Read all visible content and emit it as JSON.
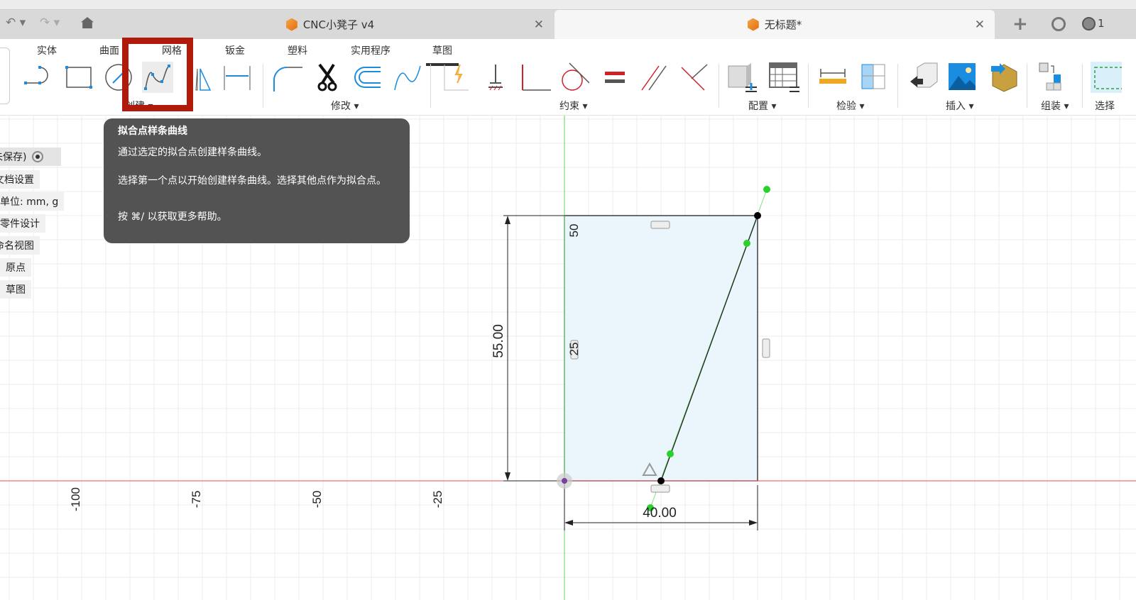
{
  "tabs": [
    {
      "label": "CNC小凳子 v4",
      "active": false
    },
    {
      "label": "无标题*",
      "active": true
    }
  ],
  "tabbar_right": {
    "add": "+",
    "jobs_count": "1"
  },
  "categories": [
    "实体",
    "曲面",
    "网格",
    "钣金",
    "塑料",
    "实用程序",
    "草图"
  ],
  "active_category": "草图",
  "groups": {
    "create": "创建",
    "modify": "修改",
    "constrain": "约束",
    "configure": "配置",
    "inspect": "检验",
    "insert": "插入",
    "assemble": "组装",
    "select": "选择"
  },
  "tooltip": {
    "title": "拟合点样条曲线",
    "line1": "通过选定的拟合点创建样条曲线。",
    "line2": "选择第一个点以开始创建样条曲线。选择其他点作为拟合点。",
    "line3": "按 ⌘/ 以获取更多帮助。"
  },
  "browser": [
    "未保存)",
    "文档设置",
    "单位: mm, g",
    "零件设计",
    "命名视图",
    "原点",
    "草图"
  ],
  "canvas": {
    "axis_labels": [
      "-100",
      "-75",
      "-50",
      "-25"
    ],
    "grid_labels": [
      "50",
      "25"
    ],
    "dimension_height": "55.00",
    "dimension_width": "40.00",
    "colors": {
      "x_axis": "#e05050",
      "y_axis": "#5fd35f",
      "profile_fill": "#eaf6fc",
      "fit_point": "#2bd12b",
      "highlight": "#b01a0a"
    }
  }
}
